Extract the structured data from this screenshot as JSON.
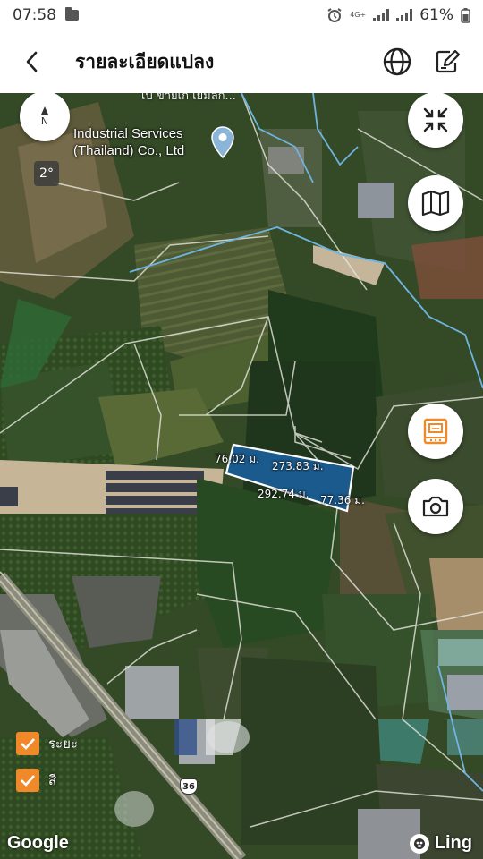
{
  "status_bar": {
    "time": "07:58",
    "network": "4G+",
    "battery": "61%"
  },
  "app_bar": {
    "title": "รายละเอียดแปลง",
    "back_icon": "chevron-left-icon",
    "globe_icon": "globe-icon",
    "edit_icon": "edit-note-icon"
  },
  "map": {
    "compass_label": "N",
    "tilt_label": "2°",
    "poi_name_line1": "Industrial Services",
    "poi_name_line2": "(Thailand) Co., Ltd",
    "top_cut_label": "เบ ขายเก เยมลก...",
    "highway_number": "36",
    "parcel": {
      "fill_color": "#1b5a8c",
      "side_left": "76.02 ม.",
      "side_top": "273.83 ม.",
      "side_bottom": "292.74 ม.",
      "side_right": "77.36 ม."
    },
    "legend": [
      {
        "label": "ระยะ",
        "checked": true
      },
      {
        "label": "สี",
        "checked": true
      }
    ],
    "attribution": "Google",
    "brand": "Ling"
  },
  "buttons": {
    "collapse_icon": "collapse-arrows-icon",
    "map_layers_icon": "map-icon",
    "calculator_icon": "calculator-icon",
    "camera_icon": "camera-icon"
  },
  "colors": {
    "accent_orange": "#f0892a",
    "parcel_blue": "#1b5a8c",
    "water_blue": "#6fb4e0"
  }
}
